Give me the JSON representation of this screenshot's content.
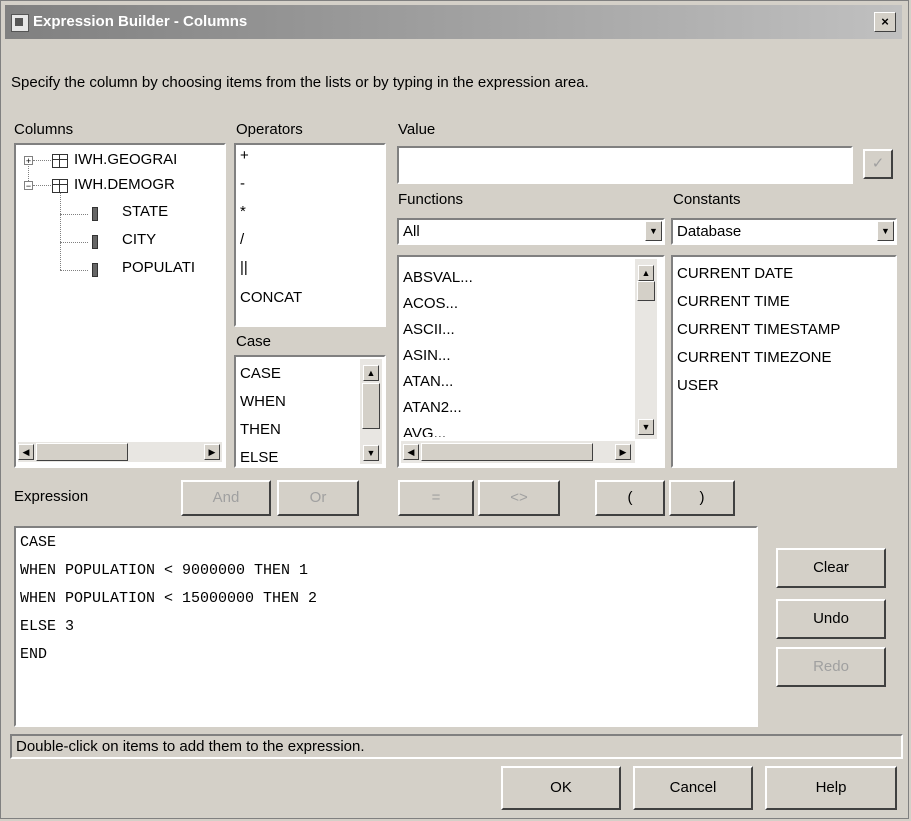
{
  "window": {
    "title": "Expression Builder - Columns",
    "close_label": "×"
  },
  "instructions": "Specify the column by choosing items from the lists or by typing in the expression area.",
  "columns": {
    "label": "Columns",
    "tables": [
      "IWH.GEOGRAI",
      "IWH.DEMOGR"
    ],
    "fields": [
      "STATE",
      "CITY",
      "POPULATI"
    ]
  },
  "operators": {
    "label": "Operators",
    "items": [
      "+",
      "-",
      "*",
      "/",
      "||",
      "CONCAT"
    ]
  },
  "case": {
    "label": "Case",
    "items": [
      "CASE",
      "WHEN",
      "THEN",
      "ELSE"
    ]
  },
  "value": {
    "label": "Value",
    "input_value": "",
    "check_label": "✓"
  },
  "functions": {
    "label": "Functions",
    "selected": "All",
    "items": [
      "ABSVAL...",
      "ACOS...",
      "ASCII...",
      "ASIN...",
      "ATAN...",
      "ATAN2...",
      "AVG..."
    ]
  },
  "constants": {
    "label": "Constants",
    "selected": "Database",
    "items": [
      "CURRENT DATE",
      "CURRENT TIME",
      "CURRENT TIMESTAMP",
      "CURRENT TIMEZONE",
      "USER"
    ]
  },
  "expression": {
    "label": "Expression",
    "buttons": {
      "and": "And",
      "or": "Or",
      "eq": "=",
      "ne": "<>",
      "lparen": "(",
      "rparen": ")"
    },
    "lines": [
      "CASE",
      "WHEN POPULATION < 9000000 THEN 1",
      "WHEN POPULATION < 15000000 THEN 2",
      "ELSE 3",
      "END"
    ]
  },
  "side_buttons": {
    "clear": "Clear",
    "undo": "Undo",
    "redo": "Redo"
  },
  "status": "Double-click on items to add them to the expression.",
  "footer": {
    "ok": "OK",
    "cancel": "Cancel",
    "help": "Help"
  },
  "icons": {
    "expand": "+",
    "collapse": "−",
    "arrow_up": "▲",
    "arrow_down": "▼",
    "arrow_left": "◀",
    "arrow_right": "▶"
  }
}
